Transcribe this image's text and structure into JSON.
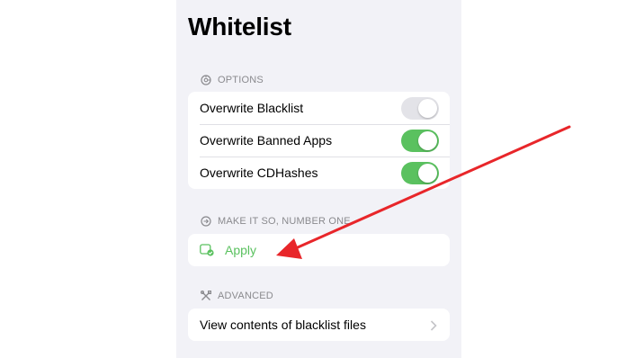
{
  "page": {
    "title": "Whitelist"
  },
  "options": {
    "header": "OPTIONS",
    "header_icon": "gear-icon",
    "items": [
      {
        "label": "Overwrite Blacklist",
        "enabled": false
      },
      {
        "label": "Overwrite Banned Apps",
        "enabled": true
      },
      {
        "label": "Overwrite CDHashes",
        "enabled": true
      }
    ]
  },
  "apply_section": {
    "header": "MAKE IT SO, NUMBER ONE",
    "header_icon": "arrow-circle-icon",
    "apply_label": "Apply",
    "apply_icon": "apply-checkmark-icon"
  },
  "advanced": {
    "header": "ADVANCED",
    "header_icon": "tools-icon",
    "item_label": "View contents of blacklist files",
    "item_icon": "chevron-right-icon"
  },
  "colors": {
    "accent_green": "#5ac15f",
    "annotation_red": "#e8262a",
    "background": "#f2f2f7"
  }
}
